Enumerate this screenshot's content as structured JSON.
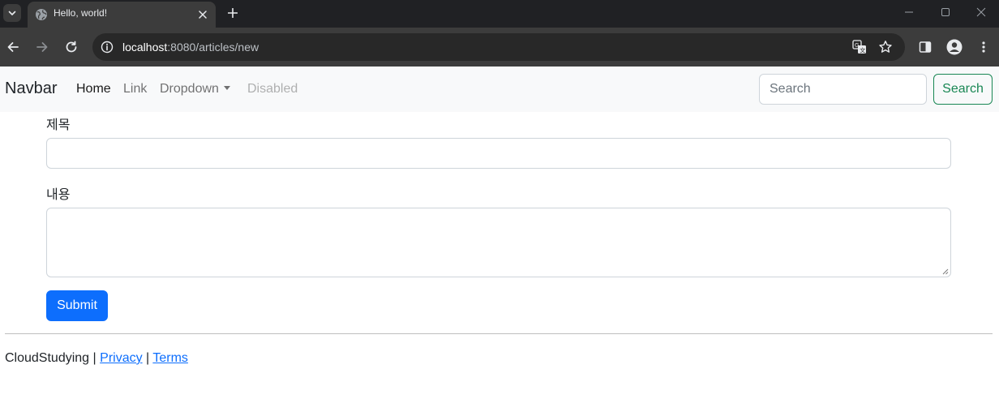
{
  "browser": {
    "tab_title": "Hello, world!",
    "url_host": "localhost",
    "url_path": ":8080/articles/new"
  },
  "icons": {
    "tab_search": "chevron-down-icon",
    "favicon": "globe-icon",
    "tab_close": "close-icon",
    "new_tab": "plus-icon",
    "minimize": "minimize-icon",
    "maximize": "maximize-icon",
    "window_close": "close-icon",
    "back": "arrow-left-icon",
    "forward": "arrow-right-icon",
    "reload": "reload-icon",
    "site_info": "info-icon",
    "translate": "translate-icon",
    "bookmark": "star-icon",
    "side_panel": "side-panel-icon",
    "profile": "person-icon",
    "menu": "kebab-menu-icon"
  },
  "navbar": {
    "brand": "Navbar",
    "links": [
      {
        "label": "Home",
        "state": "active"
      },
      {
        "label": "Link",
        "state": "normal"
      },
      {
        "label": "Dropdown",
        "state": "dropdown"
      },
      {
        "label": "Disabled",
        "state": "disabled"
      }
    ],
    "search": {
      "placeholder": "Search",
      "button_label": "Search"
    }
  },
  "form": {
    "title_label": "제목",
    "title_value": "",
    "content_label": "내용",
    "content_value": "",
    "submit_label": "Submit"
  },
  "footer": {
    "company": "CloudStudying",
    "separator": "|",
    "privacy": "Privacy",
    "terms": "Terms"
  },
  "colors": {
    "primary": "#0d6efd",
    "success": "#198754",
    "navbar_bg": "#f8f9fa",
    "chrome_dark": "#202124",
    "chrome_toolbar": "#3c3c3c"
  }
}
